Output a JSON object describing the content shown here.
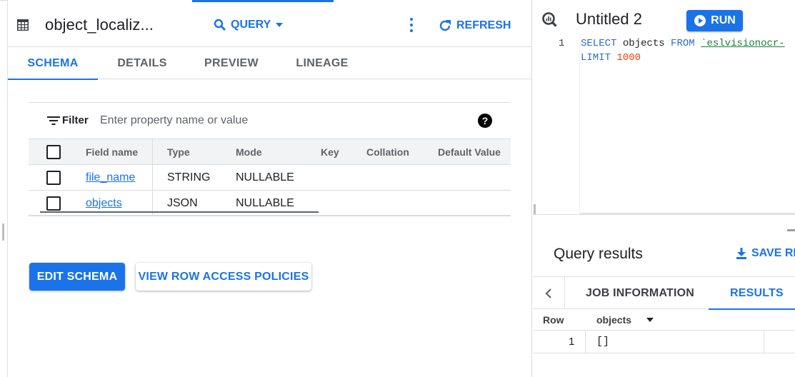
{
  "table_panel": {
    "title": "object_localiz...",
    "query_label": "QUERY",
    "refresh_label": "REFRESH",
    "tabs": [
      {
        "label": "SCHEMA",
        "active": true
      },
      {
        "label": "DETAILS",
        "active": false
      },
      {
        "label": "PREVIEW",
        "active": false
      },
      {
        "label": "LINEAGE",
        "active": false
      }
    ],
    "filter": {
      "label": "Filter",
      "placeholder": "Enter property name or value",
      "value": ""
    },
    "help_symbol": "?",
    "schema": {
      "columns": [
        "Field name",
        "Type",
        "Mode",
        "Key",
        "Collation",
        "Default Value"
      ],
      "rows": [
        {
          "field": "file_name",
          "type": "STRING",
          "mode": "NULLABLE",
          "key": "",
          "collation": "",
          "default": ""
        },
        {
          "field": "objects",
          "type": "JSON",
          "mode": "NULLABLE",
          "key": "",
          "collation": "",
          "default": ""
        }
      ]
    },
    "edit_schema_label": "EDIT SCHEMA",
    "row_access_label": "VIEW ROW ACCESS POLICIES"
  },
  "query_panel": {
    "title": "Untitled 2",
    "run_label": "RUN",
    "editor": {
      "line_number": "1",
      "kw_select": "SELECT",
      "col": " objects ",
      "kw_from": "FROM",
      "table_ref": "`eslvisionocr-",
      "kw_limit": "LIMIT",
      "limit_value": "1000"
    },
    "results": {
      "title": "Query results",
      "save_label": "SAVE RE",
      "tabs": [
        {
          "label": "JOB INFORMATION",
          "active": false
        },
        {
          "label": "RESULTS",
          "active": true
        }
      ],
      "columns": [
        "Row",
        "objects"
      ],
      "rows": [
        {
          "row": "1",
          "objects": "[]"
        }
      ]
    }
  },
  "colors": {
    "accent": "#1a73e8",
    "keyword": "#3367d6",
    "string": "#188038",
    "number": "#e8430e"
  }
}
